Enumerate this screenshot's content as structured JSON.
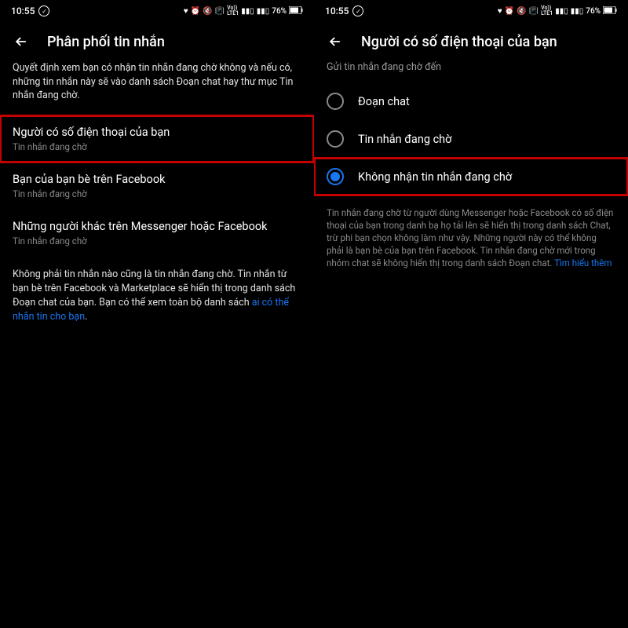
{
  "status": {
    "time": "10:55",
    "battery_percent": "76%",
    "lte": "Vo))\nLTE1"
  },
  "left": {
    "title": "Phân phối tin nhắn",
    "description": "Quyết định xem bạn có nhận tin nhắn đang chờ không và nếu có, những tin nhắn này sẽ vào danh sách Đoạn chat hay thư mục Tin nhắn đang chờ.",
    "items": [
      {
        "title": "Người có số điện thoại của bạn",
        "subtitle": "Tin nhắn đang chờ"
      },
      {
        "title": "Bạn của bạn bè trên Facebook",
        "subtitle": "Tin nhắn đang chờ"
      },
      {
        "title": "Những người khác trên Messenger hoặc Facebook",
        "subtitle": "Tin nhắn đang chờ"
      }
    ],
    "footer_text": "Không phải tin nhắn nào cũng là tin nhắn đang chờ. Tin nhắn từ bạn bè trên Facebook và Marketplace sẽ hiển thị trong danh sách Đoạn chat của bạn. Bạn có thể xem toàn bộ danh sách ",
    "footer_link": "ai có thể nhắn tin cho bạn"
  },
  "right": {
    "title": "Người có số điện thoại của bạn",
    "section_label": "Gửi tin nhắn đang chờ đến",
    "options": [
      {
        "label": "Đoạn chat",
        "selected": false
      },
      {
        "label": "Tin nhắn đang chờ",
        "selected": false
      },
      {
        "label": "Không nhận tin nhắn đang chờ",
        "selected": true
      }
    ],
    "info_text": "Tin nhắn đang chờ từ người dùng Messenger hoặc Facebook có số điện thoại của bạn trong danh bạ họ tải lên sẽ hiển thị trong danh sách Chat, trừ phi bạn chọn không làm như vậy. Những người này có thể không phải là bạn bè của bạn trên Facebook. Tin nhắn đang chờ mới trong nhóm chat sẽ không hiển thị trong danh sách Đoạn chat. ",
    "info_link": "Tìm hiểu thêm"
  }
}
